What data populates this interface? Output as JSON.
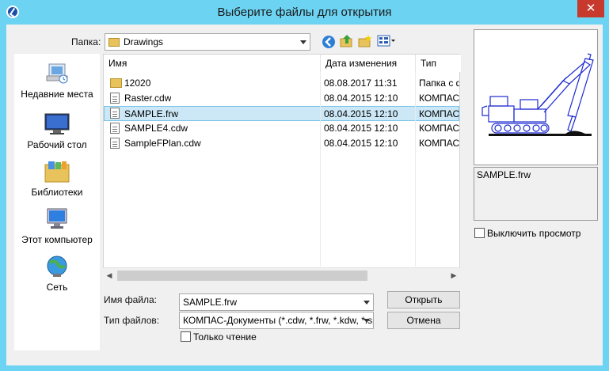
{
  "window": {
    "title": "Выберите файлы для открытия",
    "close_label": "✕"
  },
  "location": {
    "label": "Папка:",
    "current_folder": "Drawings"
  },
  "places": [
    {
      "label": "Недавние места",
      "icon": "recent-places-icon"
    },
    {
      "label": "Рабочий стол",
      "icon": "desktop-icon"
    },
    {
      "label": "Библиотеки",
      "icon": "libraries-icon"
    },
    {
      "label": "Этот компьютер",
      "icon": "computer-icon"
    },
    {
      "label": "Сеть",
      "icon": "network-icon"
    }
  ],
  "file_list": {
    "columns": [
      "Имя",
      "Дата изменения",
      "Тип"
    ],
    "rows": [
      {
        "name": "12020",
        "date": "08.08.2017 11:31",
        "type": "Папка с ф",
        "kind": "folder",
        "selected": false
      },
      {
        "name": "Raster.cdw",
        "date": "08.04.2015 12:10",
        "type": "КОМПАС",
        "kind": "document",
        "selected": false
      },
      {
        "name": "SAMPLE.frw",
        "date": "08.04.2015 12:10",
        "type": "КОМПАС",
        "kind": "document",
        "selected": true
      },
      {
        "name": "SAMPLE4.cdw",
        "date": "08.04.2015 12:10",
        "type": "КОМПАС",
        "kind": "document",
        "selected": false
      },
      {
        "name": "SampleFPlan.cdw",
        "date": "08.04.2015 12:10",
        "type": "КОМПАС",
        "kind": "document",
        "selected": false
      }
    ]
  },
  "preview": {
    "file_name": "SAMPLE.frw",
    "disable_preview_label": "Выключить просмотр",
    "disable_preview_checked": false
  },
  "form": {
    "file_name_label": "Имя файла:",
    "file_name_value": "SAMPLE.frw",
    "file_type_label": "Тип файлов:",
    "file_type_value": "КОМПАС-Документы (*.cdw, *.frw, *.kdw, *.sp",
    "read_only_label": "Только чтение",
    "read_only_checked": false,
    "open_button": "Открыть",
    "cancel_button": "Отмена"
  },
  "colors": {
    "titlebar": "#6cd3f2",
    "close_button": "#c7392d",
    "selection": "#cce8f6",
    "preview_drawing": "#1d2ad1"
  }
}
